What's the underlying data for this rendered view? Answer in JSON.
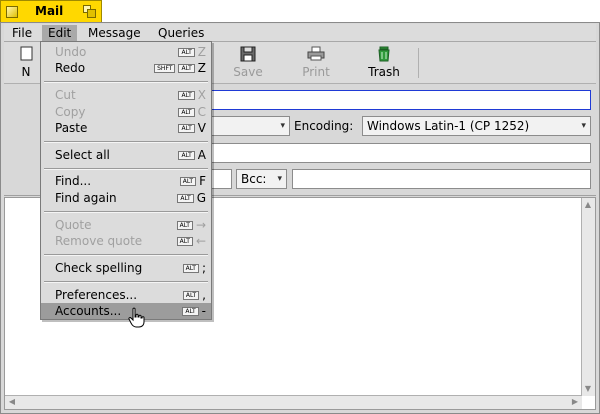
{
  "window": {
    "title": "Mail"
  },
  "menubar": {
    "items": [
      {
        "label": "File"
      },
      {
        "label": "Edit"
      },
      {
        "label": "Message"
      },
      {
        "label": "Queries"
      }
    ]
  },
  "toolbar": {
    "new_label": "N",
    "save_label": "Save",
    "print_label": "Print",
    "trash_label": "Trash"
  },
  "fields": {
    "encoding_label": "Encoding:",
    "encoding_value": "Windows Latin-1 (CP 1252)",
    "bcc_label": "Bcc:",
    "to_value": "",
    "subject_value": "",
    "bcc_value": ""
  },
  "edit_menu": {
    "undo": {
      "label": "Undo",
      "shift": "",
      "key": "Z"
    },
    "redo": {
      "label": "Redo",
      "shift": "SHFT",
      "key": "Z"
    },
    "cut": {
      "label": "Cut",
      "key": "X"
    },
    "copy": {
      "label": "Copy",
      "key": "C"
    },
    "paste": {
      "label": "Paste",
      "key": "V"
    },
    "select_all": {
      "label": "Select all",
      "key": "A"
    },
    "find": {
      "label": "Find...",
      "key": "F"
    },
    "find_again": {
      "label": "Find again",
      "key": "G"
    },
    "quote": {
      "label": "Quote",
      "key": "→"
    },
    "remove_quote": {
      "label": "Remove quote",
      "key": "←"
    },
    "check_spelling": {
      "label": "Check spelling",
      "key": ";"
    },
    "preferences": {
      "label": "Preferences...",
      "key": ","
    },
    "accounts": {
      "label": "Accounts...",
      "key": "-"
    },
    "alt_label": "ALT"
  },
  "colors": {
    "tab_yellow": "#ffd800",
    "menu_highlight": "#9c9c9c",
    "focus_border": "#1f3ad6",
    "trash_green": "#2f9a3a"
  }
}
